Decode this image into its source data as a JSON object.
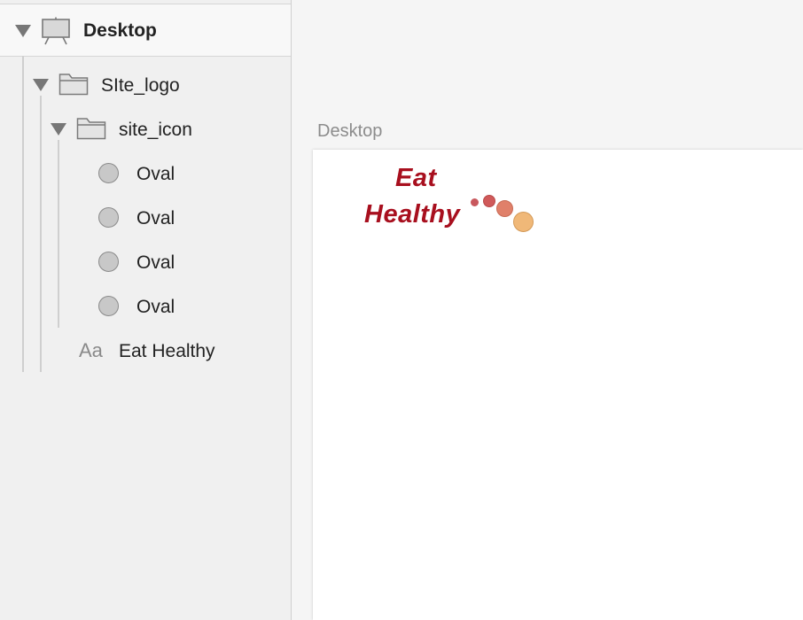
{
  "layers": {
    "artboard": {
      "label": "Desktop",
      "icon": "artboard-icon"
    },
    "group_logo": {
      "label": "SIte_logo",
      "icon": "folder-icon"
    },
    "group_icon": {
      "label": "site_icon",
      "icon": "folder-icon"
    },
    "ovals": [
      {
        "label": "Oval",
        "icon": "oval-icon"
      },
      {
        "label": "Oval",
        "icon": "oval-icon"
      },
      {
        "label": "Oval",
        "icon": "oval-icon"
      },
      {
        "label": "Oval",
        "icon": "oval-icon"
      }
    ],
    "text_layer": {
      "label": "Eat Healthy",
      "icon_glyph": "Aa"
    }
  },
  "canvas": {
    "artboard_title": "Desktop",
    "logo_line1": "Eat",
    "logo_line2": "Healthy",
    "colors": {
      "logo_text": "#a80f1e",
      "dot_small": "#c8585d",
      "dot_medium": "#d05a5a",
      "dot_large": "#e0806a",
      "dot_xlarge": "#f0b878"
    }
  }
}
